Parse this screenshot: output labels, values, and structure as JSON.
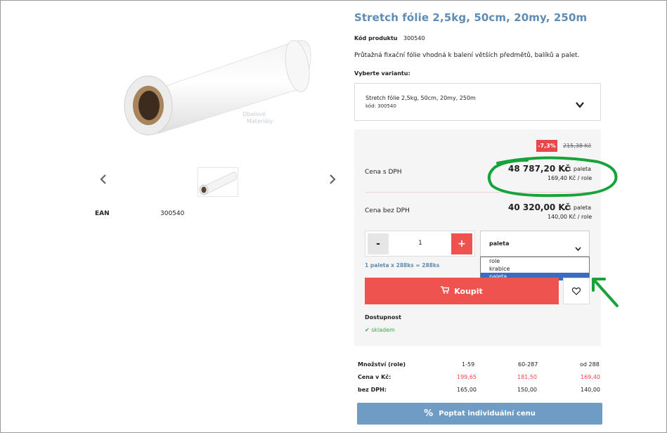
{
  "product": {
    "title": "Stretch fólie 2,5kg, 50cm, 20my, 250m",
    "code_label": "Kód produktu",
    "code_value": "300540",
    "description": "Průtažná fixační fólie vhodná k balení větších předmětů, balíků a palet.",
    "variant_label": "Vyberte variantu:",
    "variant_name": "Stretch fólie 2,5kg, 50cm, 20my, 250m",
    "variant_code": "kód: 300540",
    "watermark_line1": "Obalové",
    "watermark_line2": "Materiály"
  },
  "gallery": {
    "ean_label": "EAN",
    "ean_value": "300540"
  },
  "pricing": {
    "discount_badge": "-7,3%",
    "old_price": "215,38 Kč",
    "with_vat_label": "Cena s DPH",
    "with_vat_main": "48 787,20 Kč",
    "with_vat_unit": "/ 1 paleta",
    "with_vat_per_role": "169,40 Kč / role",
    "without_vat_label": "Cena bez DPH",
    "without_vat_main": "40 320,00 Kč",
    "without_vat_unit": "/ 1 paleta",
    "without_vat_per_role": "140,00 Kč / role"
  },
  "cart": {
    "minus": "-",
    "quantity": "1",
    "plus": "+",
    "unit_selected": "paleta",
    "unit_options": [
      "role",
      "krabice",
      "paleta"
    ],
    "conversion_note": "1 paleta x 288ks = 288ks",
    "buy_label": "Koupit",
    "availability_label": "Dostupnost",
    "availability_value": "skladem"
  },
  "price_table": {
    "rows": [
      {
        "label": "Množství (role)",
        "cells": [
          "1-59",
          "60-287",
          "od 288"
        ],
        "highlight": false
      },
      {
        "label": "Cena v Kč:",
        "cells": [
          "199,65",
          "181,50",
          "169,40"
        ],
        "highlight": true
      },
      {
        "label": "bez DPH:",
        "cells": [
          "165,00",
          "150,00",
          "140,00"
        ],
        "highlight": false
      }
    ]
  },
  "inquiry": {
    "label": "Poptat individuální cenu"
  },
  "colors": {
    "accent_blue": "#5e8cb3",
    "buy_red": "#ef5350",
    "annotation_green": "#17a33a",
    "price_red": "#e8474a"
  }
}
